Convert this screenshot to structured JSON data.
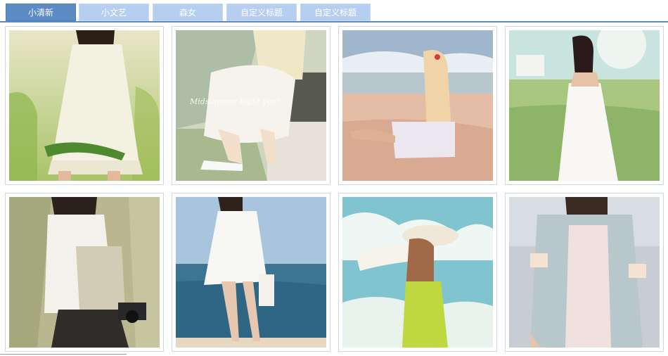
{
  "tabs": [
    {
      "label": "小清新",
      "active": true
    },
    {
      "label": "小文艺",
      "active": false
    },
    {
      "label": "森女",
      "active": false
    },
    {
      "label": "自定义标题",
      "active": false
    },
    {
      "label": "自定义标题",
      "active": false
    }
  ],
  "photos": [
    {
      "name": "girl-white-dress-grass-photo"
    },
    {
      "name": "girl-sitting-white-skirt-photo",
      "caption": "Midsummer Light year"
    },
    {
      "name": "girl-sitting-on-beach-photo"
    },
    {
      "name": "girl-white-dress-field-photo"
    },
    {
      "name": "girl-with-tote-bag-camera-photo"
    },
    {
      "name": "girl-walking-by-sea-photo"
    },
    {
      "name": "girl-with-straw-hat-photo"
    },
    {
      "name": "girl-grey-cardigan-photo"
    }
  ],
  "colors": {
    "tab_active": "#5d8bc4",
    "tab_inactive": "#b6cff1",
    "frame_border": "#cfd8e3"
  }
}
